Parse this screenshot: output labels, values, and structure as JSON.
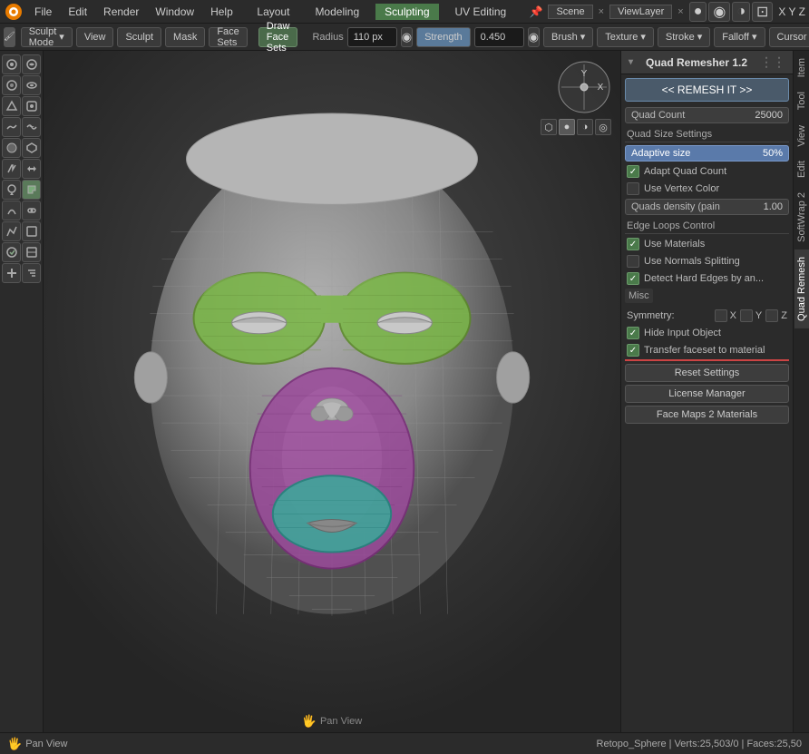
{
  "window": {
    "title": "Blender"
  },
  "top_menu": {
    "items": [
      "Blender",
      "File",
      "Edit",
      "Render",
      "Window",
      "Help"
    ],
    "center_items": [
      "Layout",
      "Modeling",
      "Sculpting",
      "UV Editing"
    ],
    "scene_label": "Scene",
    "viewlayer_label": "ViewLayer"
  },
  "toolbar": {
    "mode_label": "Sculpt Mode",
    "view_label": "View",
    "sculpt_label": "Sculpt",
    "mask_label": "Mask",
    "face_sets_label": "Face Sets",
    "active_tool": "Draw Face Sets",
    "radius_label": "Radius",
    "radius_value": "110 px",
    "strength_label": "Strength",
    "strength_value": "0.450",
    "brush_label": "Brush",
    "texture_label": "Texture",
    "stroke_label": "Stroke",
    "falloff_label": "Falloff",
    "cursor_label": "Cursor",
    "xyz_label": "X Y Z"
  },
  "left_panel": {
    "buttons": [
      {
        "icon": "●",
        "active": false
      },
      {
        "icon": "◉",
        "active": false
      },
      {
        "icon": "●",
        "active": false
      },
      {
        "icon": "◉",
        "active": false
      },
      {
        "icon": "●",
        "active": false
      },
      {
        "icon": "◉",
        "active": false
      },
      {
        "icon": "●",
        "active": false
      },
      {
        "icon": "◉",
        "active": false
      },
      {
        "icon": "●",
        "active": false
      },
      {
        "icon": "◉",
        "active": false
      },
      {
        "icon": "✏",
        "active": false
      },
      {
        "icon": "↗",
        "active": false
      },
      {
        "icon": "◉",
        "active": false
      },
      {
        "icon": "◑",
        "active": true
      },
      {
        "icon": "●",
        "active": false
      },
      {
        "icon": "◉",
        "active": false
      },
      {
        "icon": "↔",
        "active": false
      },
      {
        "icon": "↕",
        "active": false
      },
      {
        "icon": "⊞",
        "active": false
      },
      {
        "icon": "⊡",
        "active": false
      },
      {
        "icon": "⊕",
        "active": false
      },
      {
        "icon": "⊗",
        "active": false
      }
    ]
  },
  "right_panel": {
    "header": "Quad Remesher 1.2",
    "remesh_btn": "<< REMESH IT >>",
    "quad_count_label": "Quad Count",
    "quad_count_value": "25000",
    "quad_size_label": "Quad Size Settings",
    "adaptive_label": "Adaptive size",
    "adaptive_value": "50%",
    "adapt_quad_check": true,
    "adapt_quad_label": "Adapt Quad Count",
    "use_vertex_check": false,
    "use_vertex_label": "Use Vertex Color",
    "quads_density_label": "Quads density (pain",
    "quads_density_value": "1.00",
    "edge_loops_label": "Edge Loops Control",
    "use_materials_check": true,
    "use_materials_label": "Use Materials",
    "use_normals_check": false,
    "use_normals_label": "Use Normals Splitting",
    "detect_hard_check": true,
    "detect_hard_label": "Detect Hard Edges by an...",
    "misc_label": "Misc",
    "symmetry_label": "Symmetry:",
    "sym_x_check": false,
    "sym_x_label": "X",
    "sym_y_check": false,
    "sym_y_label": "Y",
    "sym_z_check": false,
    "sym_z_label": "Z",
    "hide_input_check": true,
    "hide_input_label": "Hide Input Object",
    "transfer_faceset_check": true,
    "transfer_faceset_label": "Transfer faceset to material",
    "reset_settings_btn": "Reset Settings",
    "license_manager_btn": "License Manager",
    "face_maps_btn": "Face Maps 2 Materials"
  },
  "far_tabs": {
    "items": [
      "Item",
      "Tool",
      "View",
      "Edit",
      "SoftWrap 2",
      "Quad Remesh"
    ]
  },
  "status_bar": {
    "pan_label": "Pan View",
    "info": "Retopo_Sphere | Verts:25,503/0 | Faces:25,50"
  }
}
